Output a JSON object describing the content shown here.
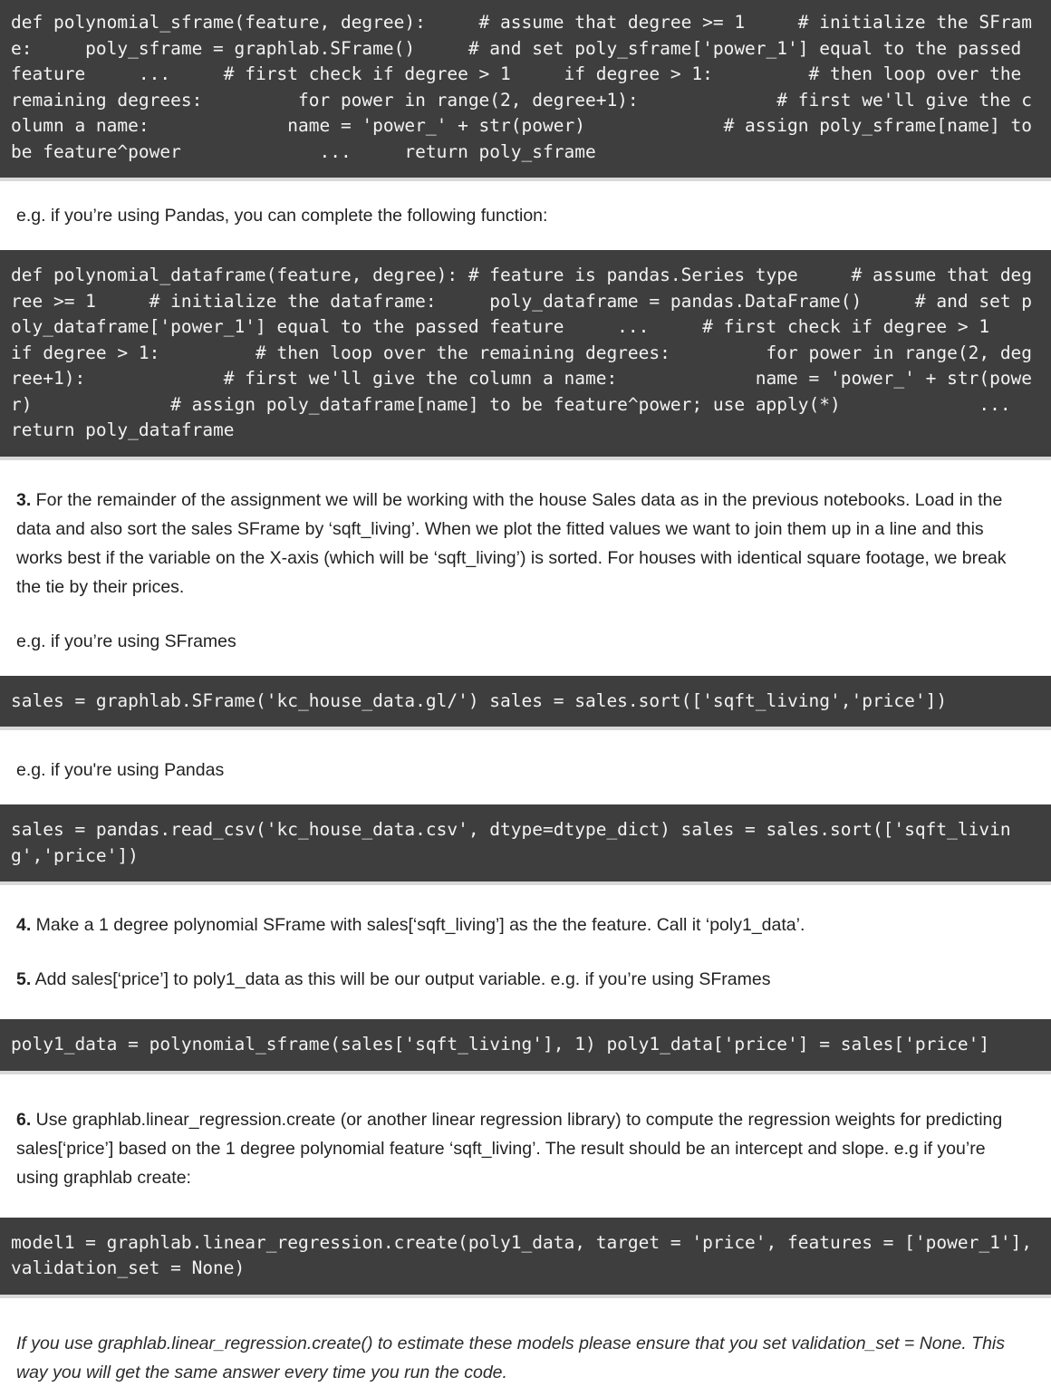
{
  "document": {
    "type": "assignment-instructions",
    "colors": {
      "code_background": "#3e3e3e",
      "code_text": "#f2f2f2",
      "page_background": "#ffffff",
      "body_text": "#222222",
      "separator": "#d9d9d9"
    }
  },
  "blocks": {
    "code_polynomial_sframe": "def polynomial_sframe(feature, degree):     # assume that degree >= 1     # initialize the SFrame:     poly_sframe = graphlab.SFrame()     # and set poly_sframe['power_1'] equal to the passed feature     ...     # first check if degree > 1     if degree > 1:         # then loop over the remaining degrees:         for power in range(2, degree+1):             # first we'll give the column a name:             name = 'power_' + str(power)             # assign poly_sframe[name] to be feature^power             ...     return poly_sframe",
    "text_pandas_intro": "e.g. if you’re using Pandas, you can complete the following function:",
    "code_polynomial_dataframe": "def polynomial_dataframe(feature, degree): # feature is pandas.Series type     # assume that degree >= 1     # initialize the dataframe:     poly_dataframe = pandas.DataFrame()     # and set poly_dataframe['power_1'] equal to the passed feature     ...     # first check if degree > 1     if degree > 1:         # then loop over the remaining degrees:         for power in range(2, degree+1):             # first we'll give the column a name:             name = 'power_' + str(power)             # assign poly_dataframe[name] to be feature^power; use apply(*)             ...     return poly_dataframe",
    "step3": {
      "number": "3.",
      "text": " For the remainder of the assignment we will be working with the house Sales data as in the previous notebooks. Load in the data and also sort the sales SFrame by ‘sqft_living’. When we plot the fitted values we want to join them up in a line and this works best if the variable on the X-axis (which will be ‘sqft_living’) is sorted. For houses with identical square footage, we break the tie by their prices."
    },
    "text_sframes_intro": "e.g. if you’re using SFrames",
    "code_sales_sframe": "sales = graphlab.SFrame('kc_house_data.gl/') sales = sales.sort(['sqft_living','price'])",
    "text_pandas_intro2": "e.g. if you're using Pandas",
    "code_sales_pandas": "sales = pandas.read_csv('kc_house_data.csv', dtype=dtype_dict) sales = sales.sort(['sqft_living','price'])",
    "step4": {
      "number": "4.",
      "text": " Make a 1 degree polynomial SFrame with sales[‘sqft_living’] as the the feature. Call it ‘poly1_data’."
    },
    "step5": {
      "number": "5.",
      "text": " Add sales[‘price’] to poly1_data as this will be our output variable. e.g. if you’re using SFrames"
    },
    "code_poly1_data": "poly1_data = polynomial_sframe(sales['sqft_living'], 1) poly1_data['price'] = sales['price']",
    "step6": {
      "number": "6.",
      "text": " Use graphlab.linear_regression.create (or another linear regression library) to compute the regression weights for predicting sales[‘price’] based on the 1 degree polynomial feature ‘sqft_living’. The result should be an intercept and slope. e.g if you’re using graphlab create:"
    },
    "code_model1": "model1 = graphlab.linear_regression.create(poly1_data, target = 'price', features = ['power_1'], validation_set = None)",
    "note_validation": "If you use graphlab.linear_regression.create() to estimate these models please ensure that you set validation_set = None. This way you will get the same answer every time you run the code."
  }
}
